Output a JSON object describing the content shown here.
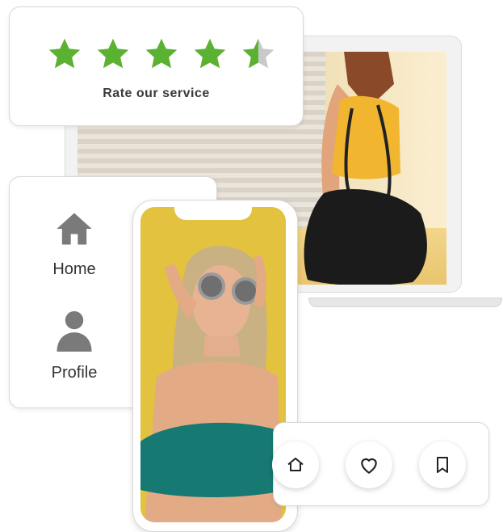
{
  "rating": {
    "label": "Rate our service",
    "value": 4.5,
    "max": 5,
    "star_color": "#5bb131",
    "empty_color": "#c9c9c9"
  },
  "nav": {
    "items": [
      {
        "label": "Home",
        "icon": "home-icon"
      },
      {
        "label": "Profile",
        "icon": "profile-icon"
      }
    ],
    "icon_color": "#7a7a7a"
  },
  "actions": {
    "items": [
      {
        "icon": "home-outline-icon"
      },
      {
        "icon": "heart-icon"
      },
      {
        "icon": "bookmark-icon"
      }
    ]
  }
}
